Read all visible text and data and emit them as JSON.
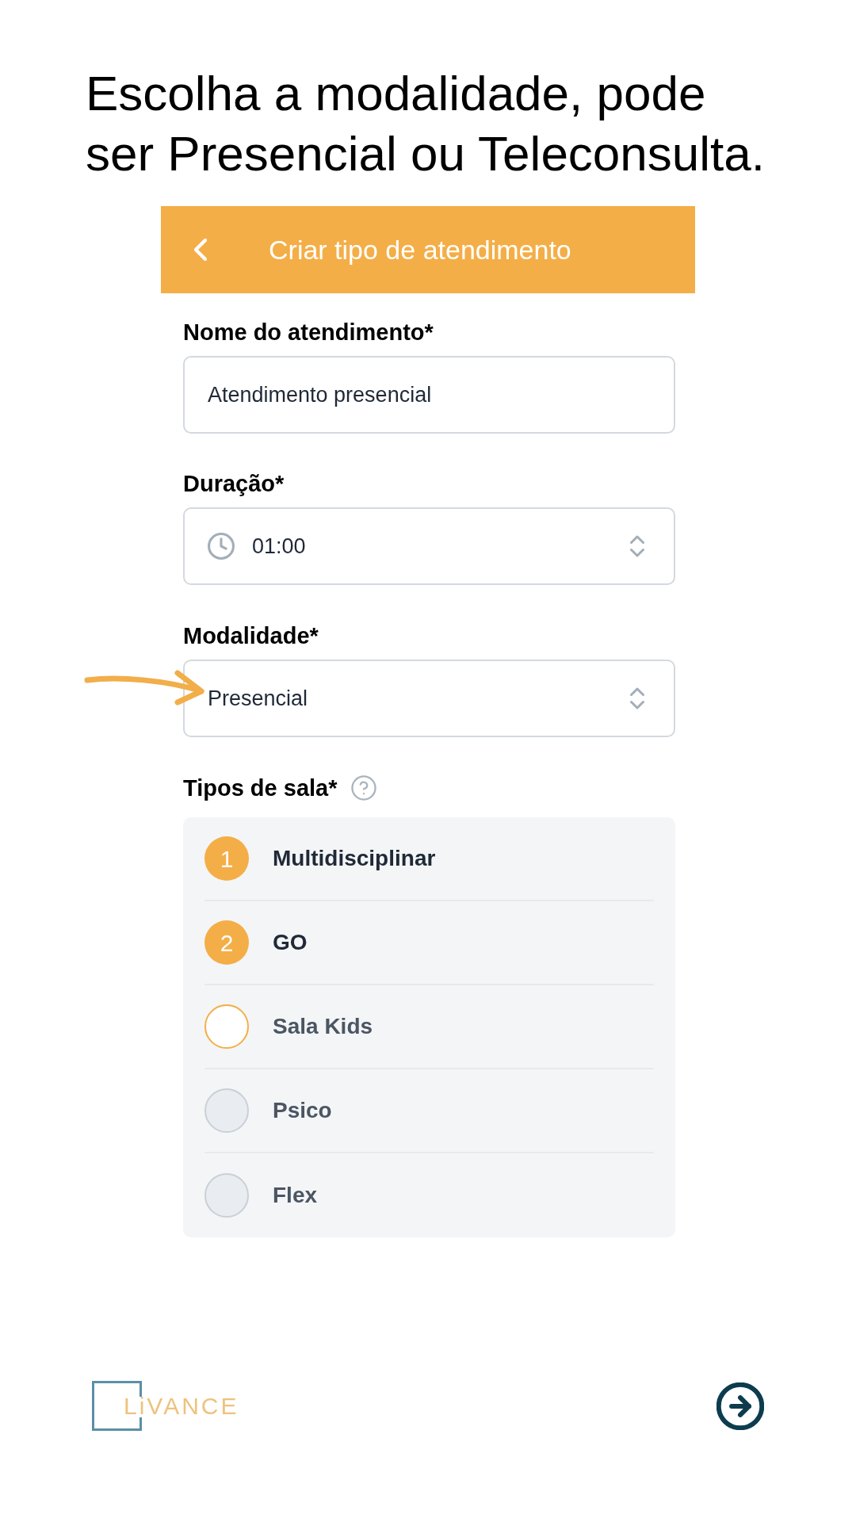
{
  "instruction_lines": [
    "Escolha a modalidade, pode",
    "ser Presencial ou Teleconsulta."
  ],
  "header": {
    "title": "Criar tipo de atendimento"
  },
  "fields": [
    {
      "kind": "text",
      "label": "Nome do atendimento*",
      "value": "Atendimento presencial",
      "annotated": false
    },
    {
      "kind": "time",
      "label": "Duração*",
      "value": "01:00",
      "annotated": false
    },
    {
      "kind": "select",
      "label": "Modalidade*",
      "value": "Presencial",
      "annotated": true
    }
  ],
  "room_types": {
    "label": "Tipos de sala*",
    "rooms": [
      {
        "name": "Multidisciplinar",
        "selected": true,
        "order": "1",
        "focused": false
      },
      {
        "name": "GO",
        "selected": true,
        "order": "2",
        "focused": false
      },
      {
        "name": "Sala Kids",
        "selected": false,
        "focused": true
      },
      {
        "name": "Psico",
        "selected": false,
        "focused": false
      },
      {
        "name": "Flex",
        "selected": false,
        "focused": false
      }
    ]
  },
  "footer": {
    "logo": "LiVANCE"
  }
}
